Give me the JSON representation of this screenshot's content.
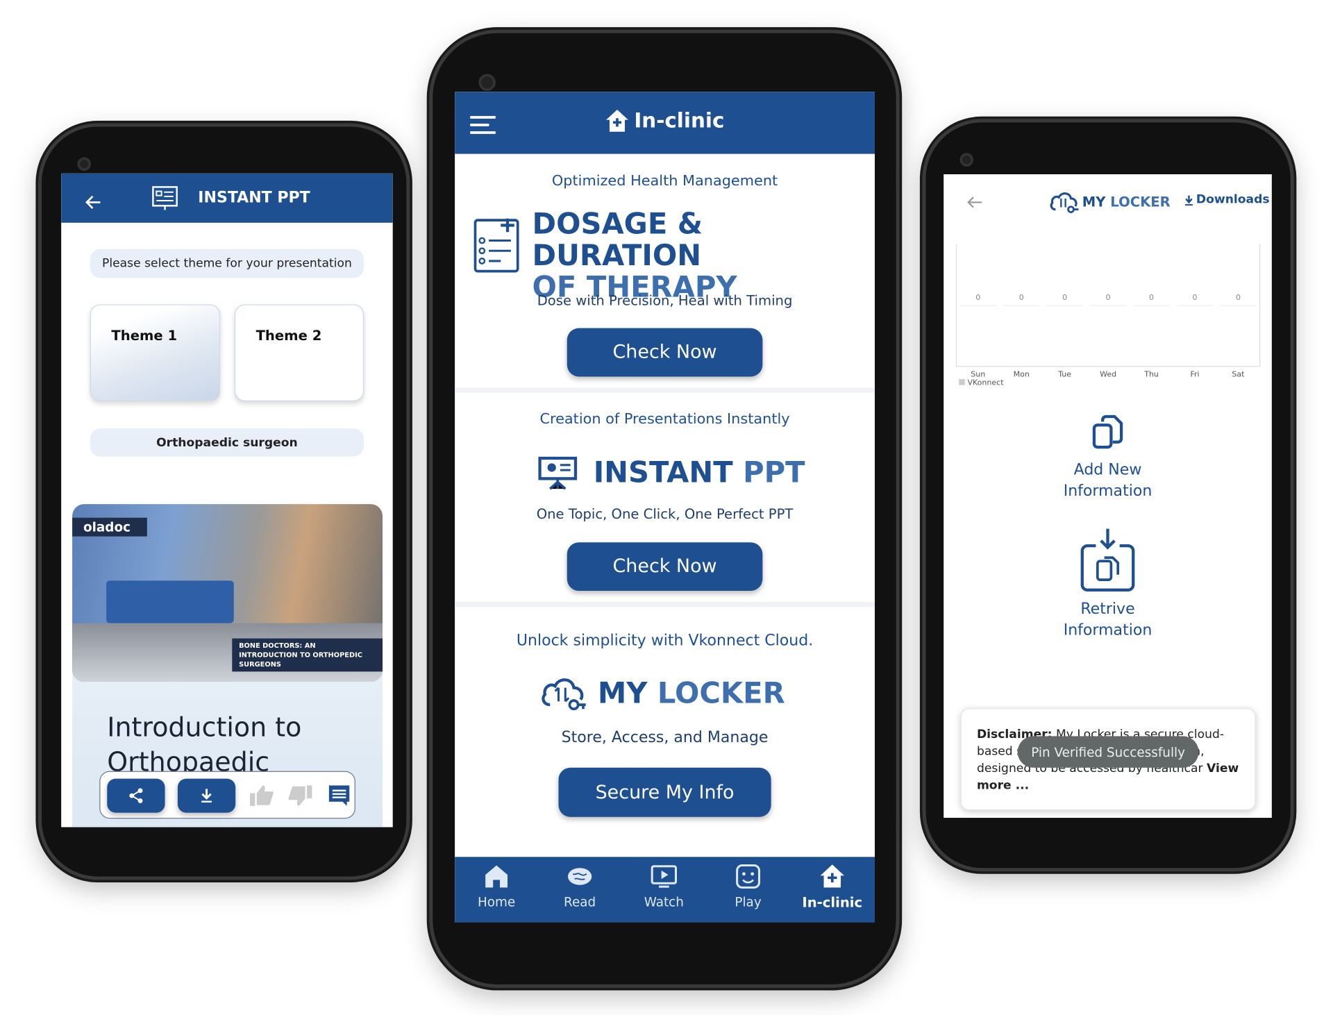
{
  "left_screen": {
    "header_title": "INSTANT PPT",
    "prompt": "Please select theme for your presentation",
    "themes": [
      "Theme 1",
      "Theme 2"
    ],
    "specialty": "Orthopaedic surgeon",
    "image_brand": "oladoc",
    "image_caption": "BONE DOCTORS: AN INTRODUCTION TO ORTHOPEDIC SURGEONS",
    "slide_title": "Introduction to Orthopaedic"
  },
  "center_screen": {
    "header_title": "In-clinic",
    "sections": [
      {
        "tagline": "Optimized Health Management",
        "title_a": "DOSAGE & DURATION",
        "title_b": "OF THERAPY",
        "subtitle": "Dose with Precision, Heal with Timing",
        "button": "Check Now"
      },
      {
        "tagline": "Creation of Presentations Instantly",
        "title_a": "INSTANT",
        "title_b": "PPT",
        "subtitle": "One Topic, One Click, One Perfect PPT",
        "button": "Check Now"
      },
      {
        "tagline": "Unlock simplicity with Vkonnect Cloud.",
        "title_a": "MY",
        "title_b": "LOCKER",
        "subtitle": "Store, Access, and Manage",
        "button": "Secure My Info"
      }
    ],
    "nav": [
      {
        "label": "Home",
        "icon": "home-icon"
      },
      {
        "label": "Read",
        "icon": "brain-icon"
      },
      {
        "label": "Watch",
        "icon": "play-screen-icon"
      },
      {
        "label": "Play",
        "icon": "smiley-icon"
      },
      {
        "label": "In-clinic",
        "icon": "clinic-icon",
        "active": true
      }
    ]
  },
  "right_screen": {
    "header_title_a": "MY",
    "header_title_b": "LOCKER",
    "downloads": "Downloads",
    "add_new": [
      "Add New",
      "Information"
    ],
    "retrieve": [
      "Retrive",
      "Information"
    ],
    "disclaimer_label": "Disclaimer:",
    "disclaimer_text": "My Locker is a secure cloud-based storage for patient information, designed to be accessed by healthcar",
    "view_more": "View more ...",
    "toast": "Pin Verified Successfully"
  },
  "chart_data": {
    "type": "bar",
    "categories": [
      "Sun",
      "Mon",
      "Tue",
      "Wed",
      "Thu",
      "Fri",
      "Sat"
    ],
    "series": [
      {
        "name": "VKonnect",
        "values": [
          0,
          0,
          0,
          0,
          0,
          0,
          0
        ]
      }
    ],
    "data_labels": [
      "0",
      "0",
      "0",
      "0",
      "0",
      "0",
      "0"
    ],
    "legend": "bottom-left",
    "colors": {
      "legend": "#cccccc"
    }
  },
  "colors": {
    "brand": "#1d4f91",
    "accent_light": "#3d6fae"
  }
}
